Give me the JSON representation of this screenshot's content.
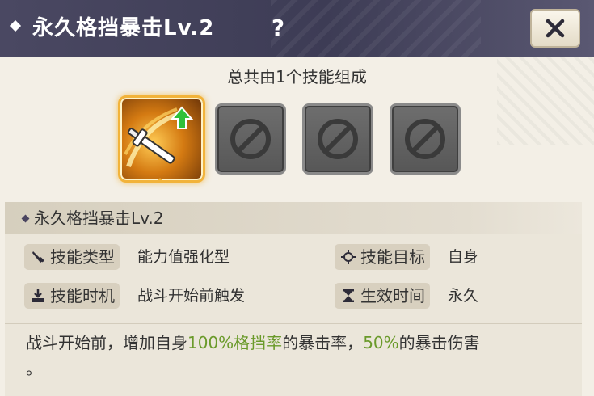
{
  "window": {
    "title": "永久格挡暴击Lv.2",
    "help_label": "?",
    "close_icon": "close-x-icon"
  },
  "composition": {
    "text": "总共由1个技能组成",
    "slots": [
      {
        "state": "filled",
        "icon": "sword-upgrade-icon"
      },
      {
        "state": "empty",
        "icon": "prohibited-icon"
      },
      {
        "state": "empty",
        "icon": "prohibited-icon"
      },
      {
        "state": "empty",
        "icon": "prohibited-icon"
      }
    ]
  },
  "skill": {
    "name": "永久格挡暴击Lv.2",
    "attributes": {
      "type_label": "技能类型",
      "type_value": "能力值强化型",
      "target_label": "技能目标",
      "target_value": "自身",
      "timing_label": "技能时机",
      "timing_value": "战斗开始前触发",
      "duration_label": "生效时间",
      "duration_value": "永久"
    },
    "description": {
      "part1": "战斗开始前，增加自身",
      "highlight1": "100%格挡率",
      "part2": "的暴击率，",
      "highlight2": "50%",
      "part3": "的暴击伤害",
      "part4": "。"
    }
  },
  "colors": {
    "highlight": "#6a9a2a",
    "title_bar": "#3d3c55",
    "active_border": "#f2b33a"
  }
}
